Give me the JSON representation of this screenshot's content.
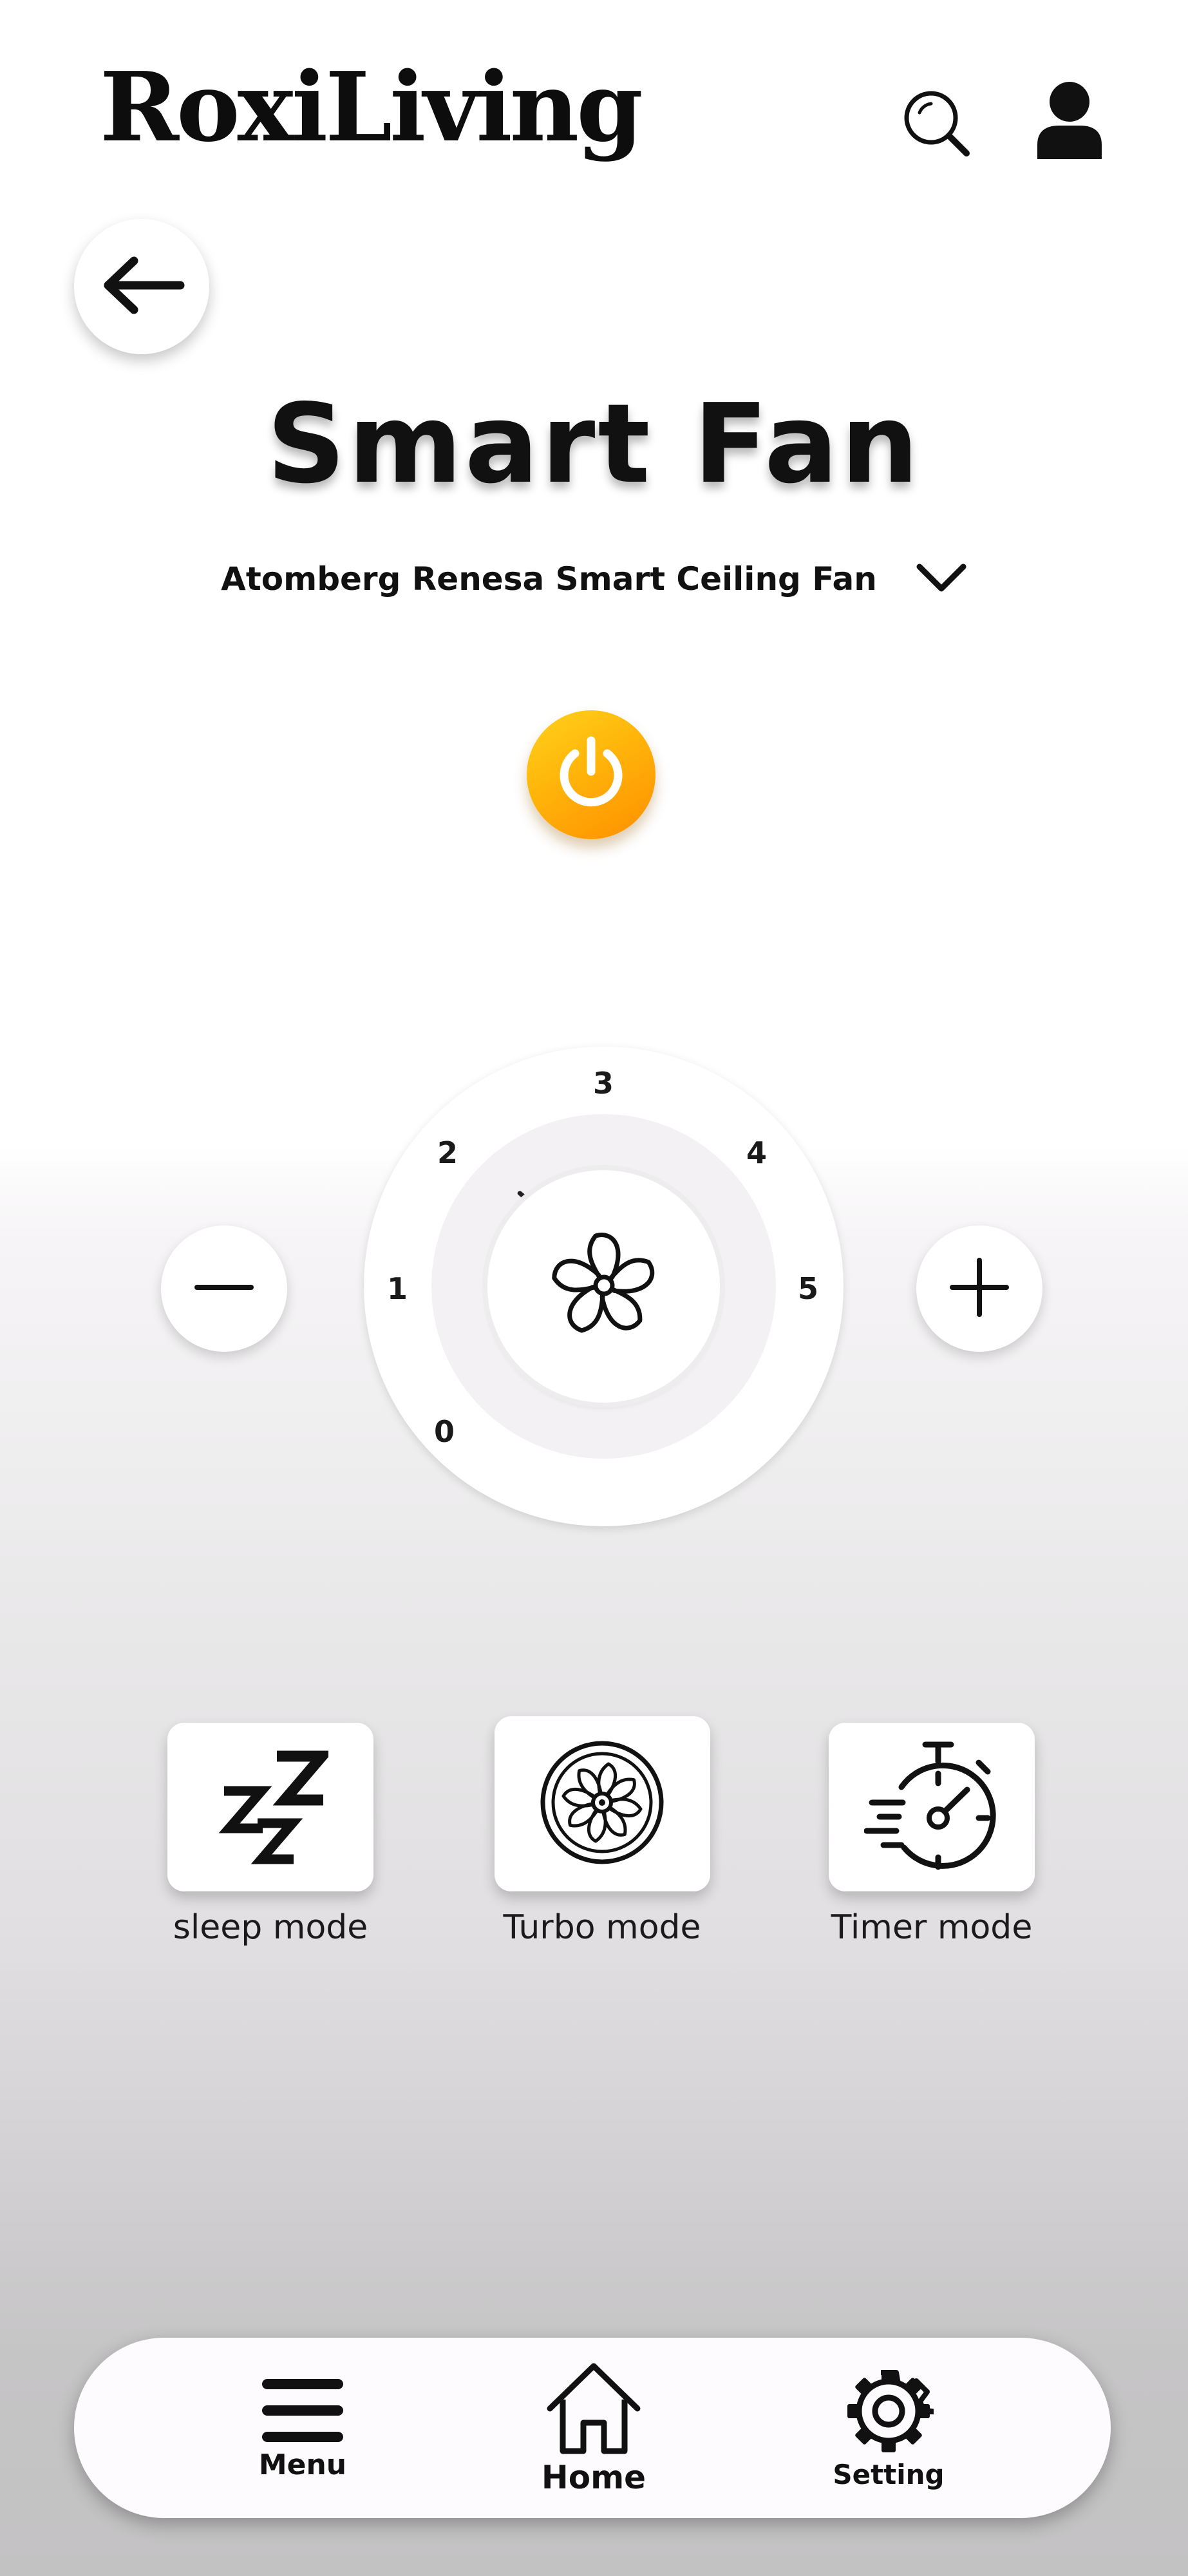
{
  "header": {
    "brand": "RoxiLiving",
    "search_icon": "search-icon",
    "profile_icon": "user-icon"
  },
  "back_icon": "arrow-left-icon",
  "title": "Smart Fan",
  "device": {
    "selected": "Atomberg Renesa Smart Ceiling Fan",
    "dropdown_icon": "chevron-down-icon"
  },
  "power": {
    "icon": "power-icon",
    "colors": {
      "start": "#ffd21c",
      "end": "#ff8f00",
      "symbol": "#ffffff"
    }
  },
  "speed_dial": {
    "labels": [
      "0",
      "1",
      "2",
      "3",
      "4",
      "5"
    ],
    "center_icon": "fan-icon",
    "decrease_icon": "minus-icon",
    "increase_icon": "plus-icon"
  },
  "modes": [
    {
      "label": "sleep mode",
      "icon": "sleep-zzz-icon"
    },
    {
      "label": "Turbo mode",
      "icon": "turbo-fan-icon"
    },
    {
      "label": "Timer mode",
      "icon": "stopwatch-icon"
    }
  ],
  "bottom_nav": [
    {
      "label": "Menu",
      "icon": "hamburger-menu-icon"
    },
    {
      "label": "Home",
      "icon": "home-icon"
    },
    {
      "label": "Setting",
      "icon": "gear-icon"
    }
  ]
}
